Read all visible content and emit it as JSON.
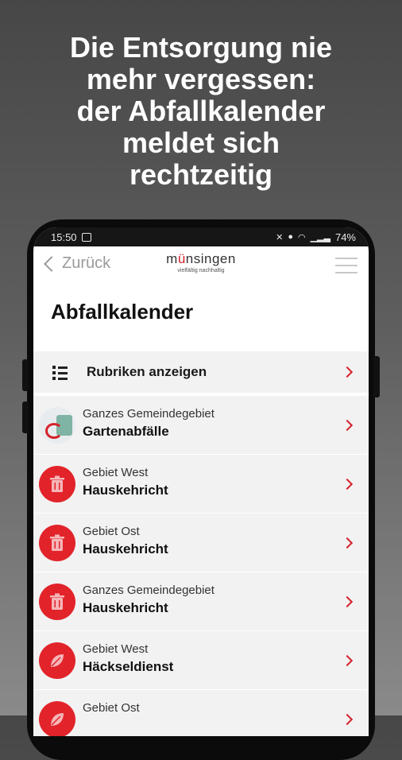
{
  "headline": "Die Entsorgung nie\nmehr vergessen:\nder Abfallkalender\nmeldet sich\nrechtzeitig",
  "statusbar": {
    "time": "15:50",
    "battery": "74%"
  },
  "nav": {
    "back_label": "Zurück",
    "logo_word_a": "m",
    "logo_word_u": "ü",
    "logo_word_b": "nsingen",
    "logo_tagline": "vielfältig nachhaltig"
  },
  "page": {
    "title": "Abfallkalender"
  },
  "rubriken": {
    "label": "Rubriken anzeigen",
    "icon": "list-icon"
  },
  "items": [
    {
      "area": "Ganzes Gemeindegebiet",
      "name": "Gartenabfälle",
      "icon": "garden-thumbnail"
    },
    {
      "area": "Gebiet West",
      "name": "Hauskehricht",
      "icon": "trash-icon"
    },
    {
      "area": "Gebiet Ost",
      "name": "Hauskehricht",
      "icon": "trash-icon"
    },
    {
      "area": "Ganzes Gemeindegebiet",
      "name": "Hauskehricht",
      "icon": "trash-icon"
    },
    {
      "area": "Gebiet West",
      "name": "Häckseldienst",
      "icon": "leaf-icon"
    },
    {
      "area": "Gebiet Ost",
      "name": "",
      "icon": "leaf-icon"
    }
  ],
  "colors": {
    "accent": "#d4222a",
    "row_bg": "#f2f2f2"
  }
}
